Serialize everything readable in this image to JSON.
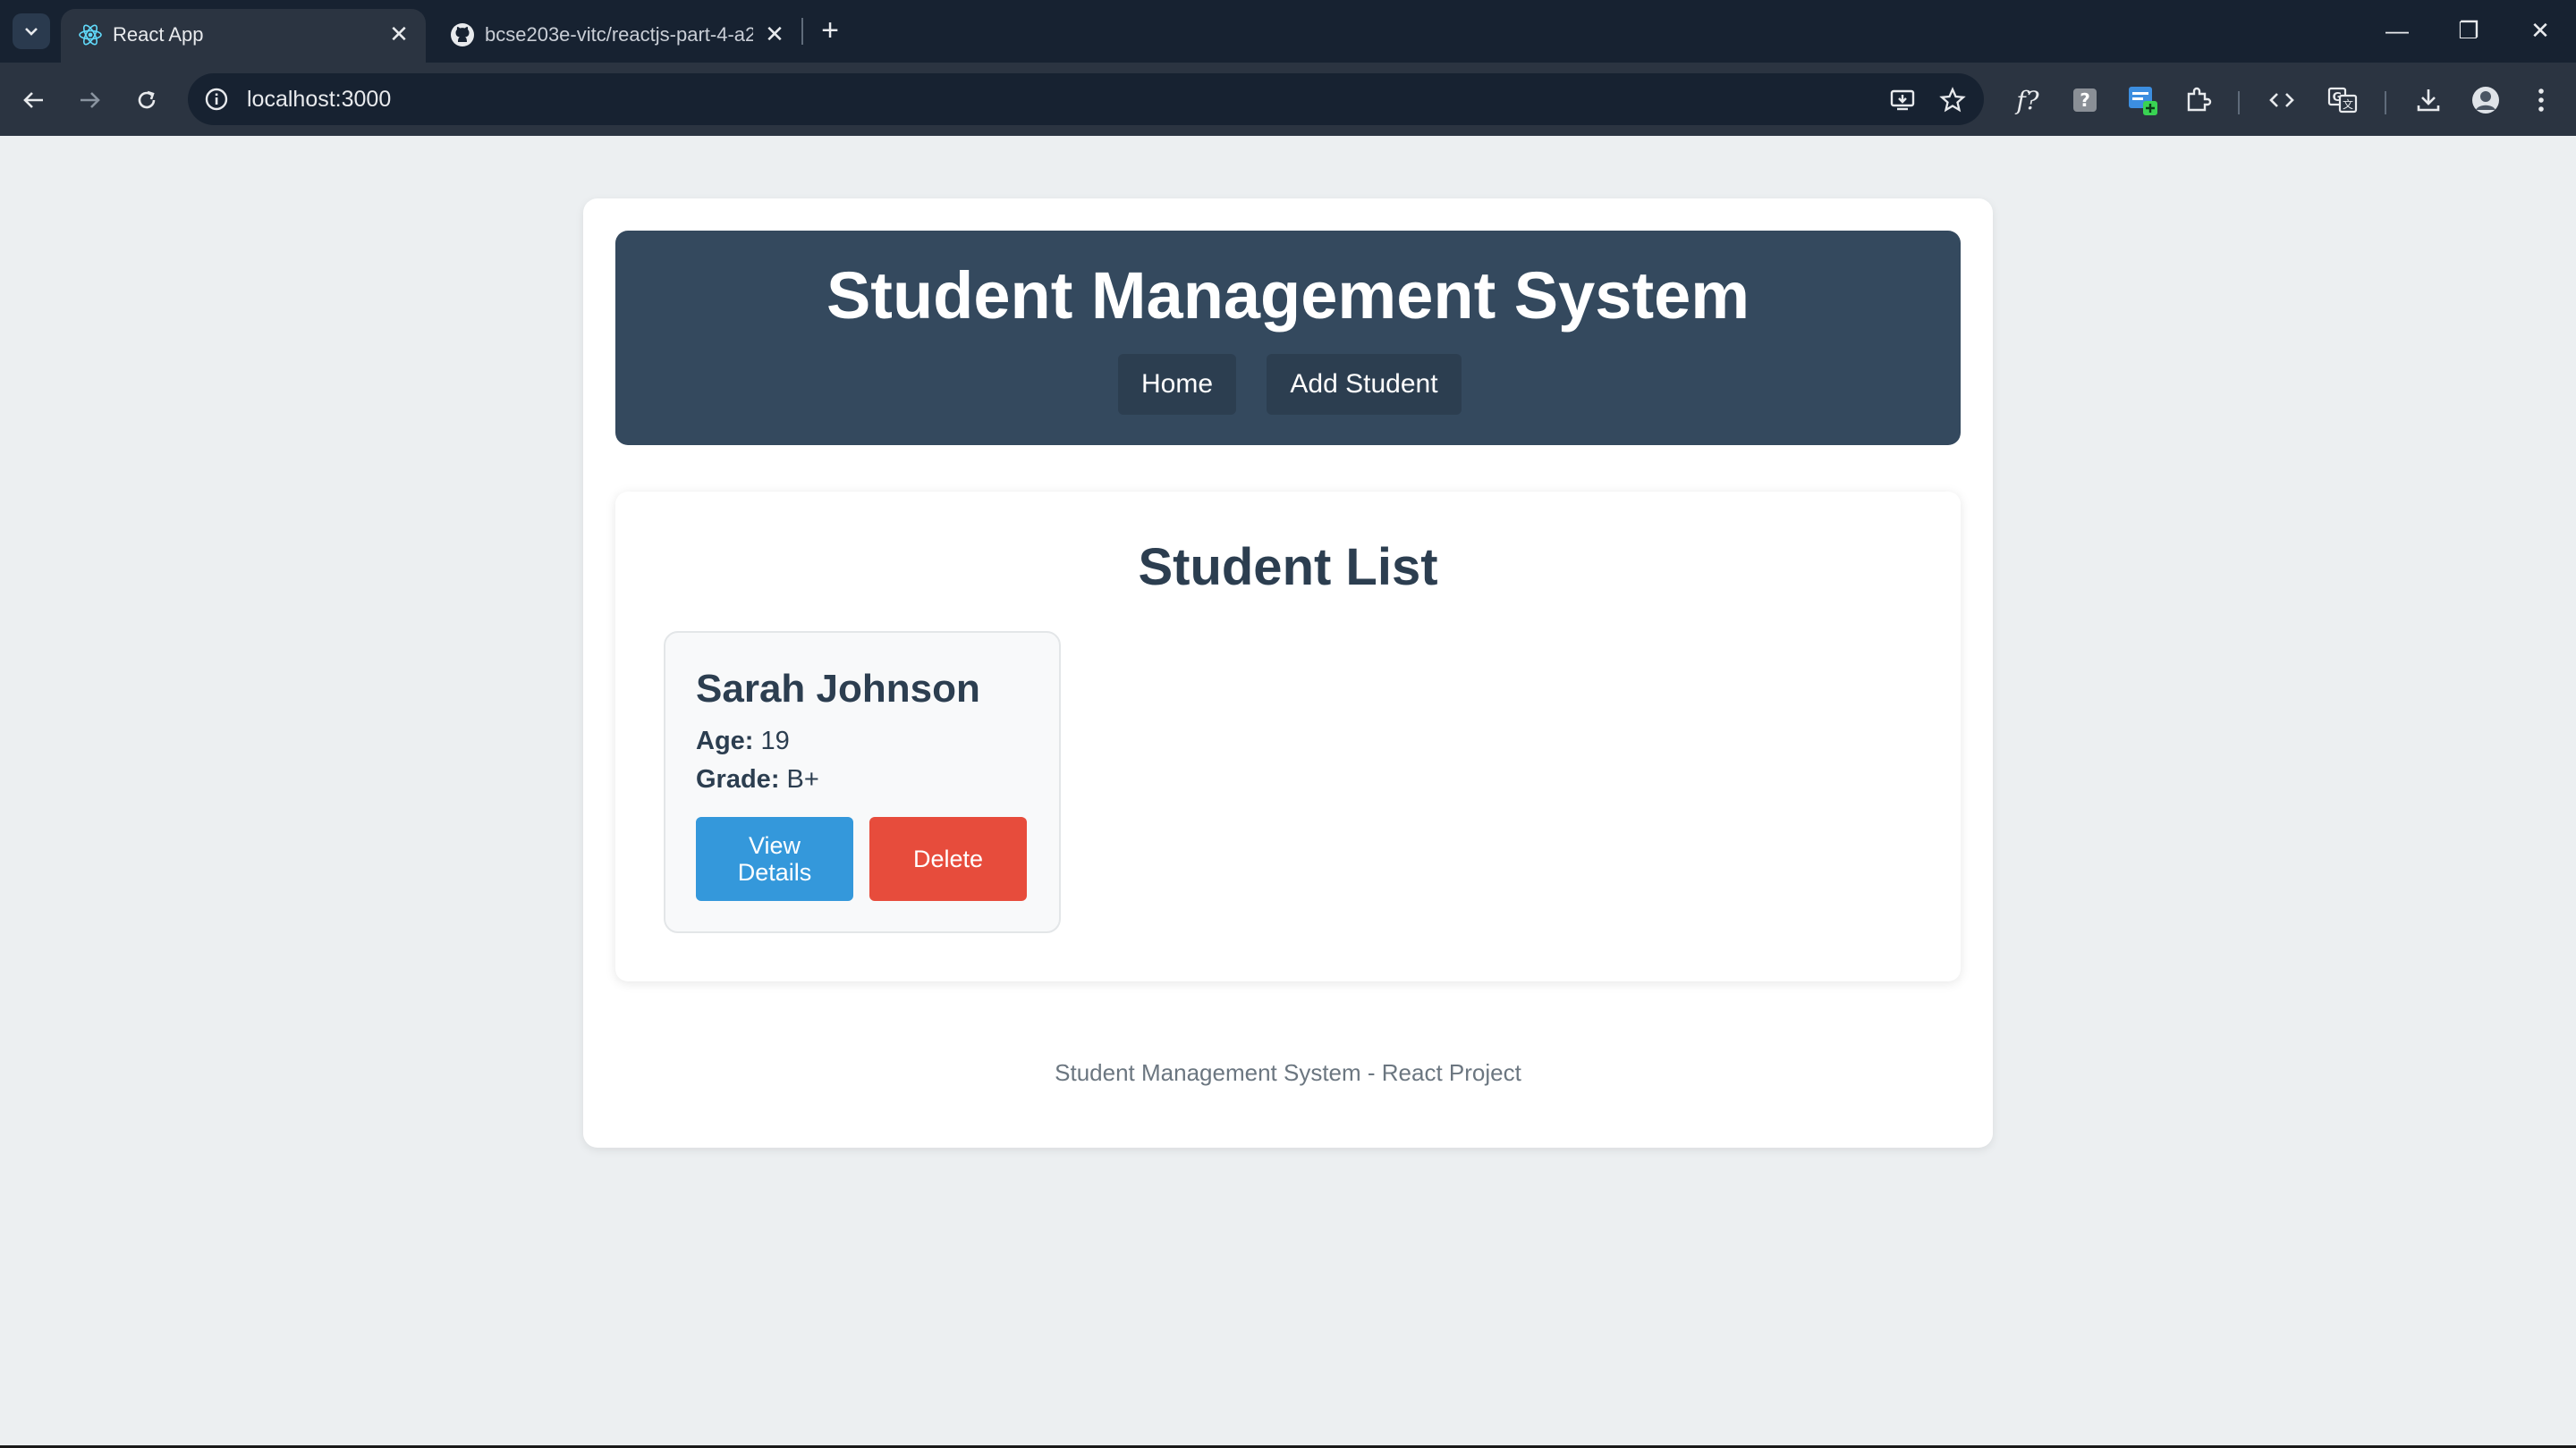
{
  "browser": {
    "tabs": [
      {
        "title": "React App",
        "active": true,
        "icon": "react-icon"
      },
      {
        "title": "bcse203e-vitc/reactjs-part-4-a2",
        "active": false,
        "icon": "github-icon"
      }
    ],
    "close_glyph": "✕",
    "new_tab_glyph": "+",
    "url": "localhost:3000",
    "window_controls": {
      "minimize": "—",
      "restore": "❐",
      "close": "✕"
    }
  },
  "app": {
    "header": {
      "title": "Student Management System",
      "nav": {
        "home": "Home",
        "add_student": "Add Student"
      }
    },
    "list": {
      "heading": "Student List",
      "students": [
        {
          "name": "Sarah Johnson",
          "age_label": "Age:",
          "age": "19",
          "grade_label": "Grade:",
          "grade": "B+",
          "view_label": "View Details",
          "delete_label": "Delete"
        }
      ]
    },
    "footer": "Student Management System - React Project"
  },
  "colors": {
    "header_bg": "#34495e",
    "nav_button_bg": "#2c3e50",
    "view_button": "#3498db",
    "delete_button": "#e74c3c",
    "page_bg": "#eceff1",
    "text_dark": "#2c3e50"
  }
}
